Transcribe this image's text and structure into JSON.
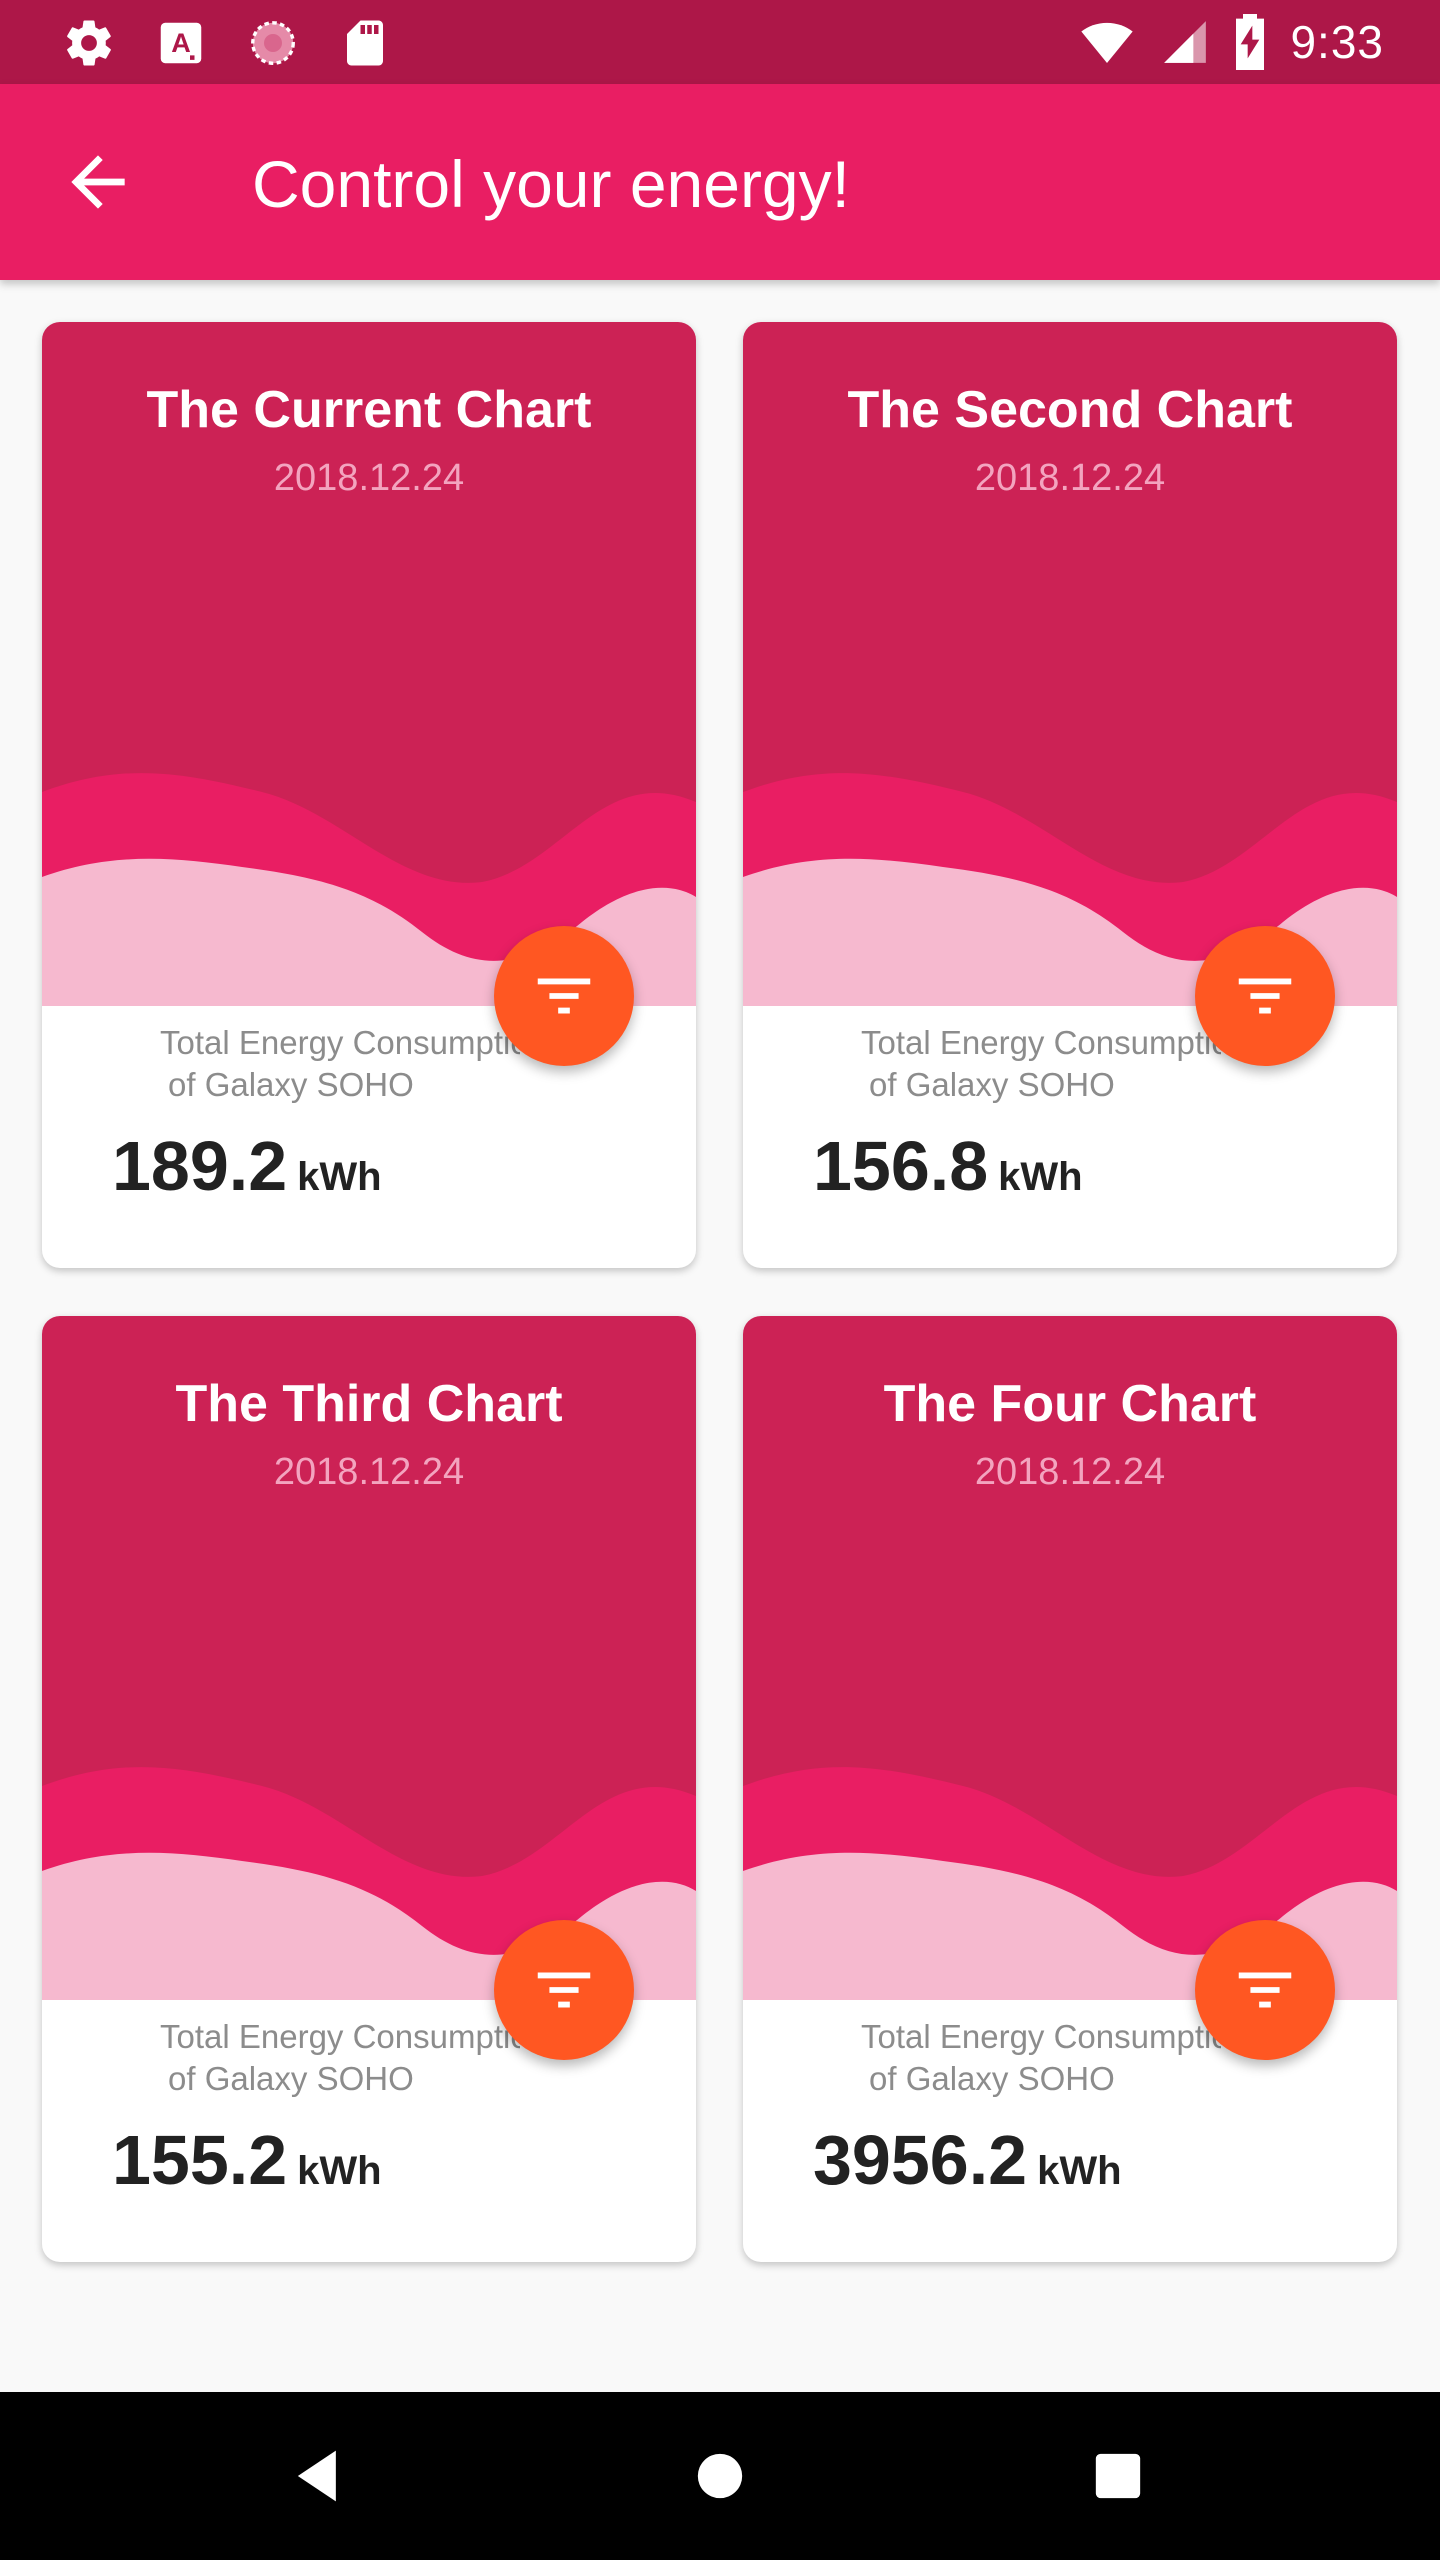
{
  "status_bar": {
    "time": "9:33",
    "left_icons": [
      "settings-icon",
      "font-a-icon",
      "loading-icon",
      "sd-card-icon"
    ],
    "right_icons": [
      "wifi-icon",
      "signal-icon",
      "battery-charging-icon"
    ]
  },
  "app_bar": {
    "title": "Control your energy!",
    "back_icon": "arrow-back-icon"
  },
  "cards": [
    {
      "title": "The Current Chart",
      "date": "2018.12.24",
      "desc_line1": "Total Energy Consumption",
      "desc_line2": "of Galaxy SOHO",
      "value": "189.2",
      "unit": "kWh"
    },
    {
      "title": "The Second Chart",
      "date": "2018.12.24",
      "desc_line1": "Total Energy Consumption",
      "desc_line2": "of Galaxy SOHO",
      "value": "156.8",
      "unit": "kWh"
    },
    {
      "title": "The Third Chart",
      "date": "2018.12.24",
      "desc_line1": "Total Energy Consumption",
      "desc_line2": "of Galaxy SOHO",
      "value": "155.2",
      "unit": "kWh"
    },
    {
      "title": "The Four Chart",
      "date": "2018.12.24",
      "desc_line1": "Total Energy Consumption",
      "desc_line2": "of Galaxy SOHO",
      "value": "3956.2",
      "unit": "kWh"
    }
  ],
  "colors": {
    "status_bar": "#ad1748",
    "app_bar": "#e91e63",
    "card_top": "#cc2255",
    "wave_mid": "#e91e63",
    "wave_light": "#f6b9cf",
    "fab": "#ff5722"
  },
  "nav_bar": {
    "icons": [
      "back-triangle-icon",
      "home-circle-icon",
      "recents-square-icon"
    ]
  }
}
